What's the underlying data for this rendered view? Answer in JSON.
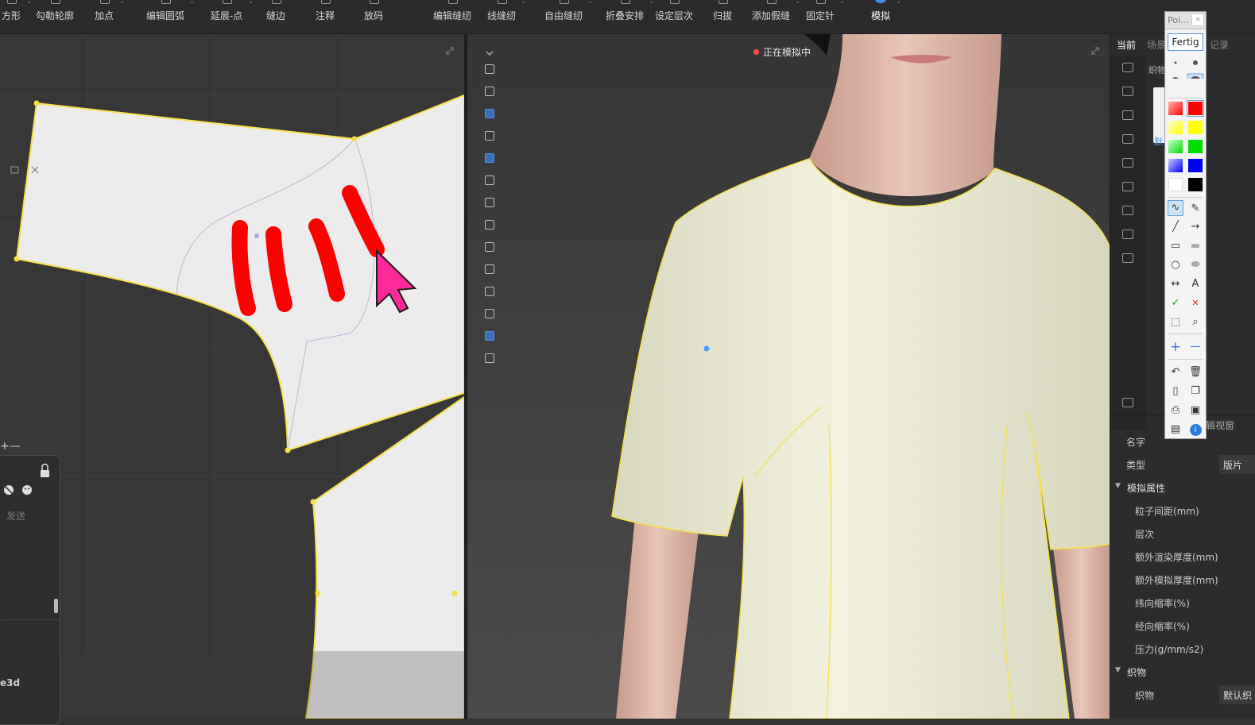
{
  "toolbar": {
    "items": [
      {
        "label": "方形"
      },
      {
        "label": "勾勒轮廓"
      },
      {
        "label": "加点"
      },
      {
        "label": "编辑圆弧"
      },
      {
        "label": "延展-点"
      },
      {
        "label": "缝边"
      },
      {
        "label": "注释"
      },
      {
        "label": "放码"
      },
      {
        "label": "编辑缝纫"
      },
      {
        "label": "线缝纫"
      },
      {
        "label": "自由缝纫"
      },
      {
        "label": "折叠安排"
      },
      {
        "label": "设定层次"
      },
      {
        "label": "归拔"
      },
      {
        "label": "添加假缝"
      },
      {
        "label": "固定针"
      },
      {
        "label": "模拟"
      }
    ],
    "caret": "⌄"
  },
  "view3d": {
    "status": "正在模拟中",
    "status_color": "#ff4d4d"
  },
  "left_panel": {
    "chat_send": "发送",
    "bottom_label": "e3d",
    "cross_mark": "+—"
  },
  "prop_panel": {
    "tabs": [
      "当前",
      "场景",
      "记录"
    ],
    "fabric_label": "织物",
    "default_link": "默",
    "edit_view_label": "辑视窗",
    "rows": [
      {
        "key": "名字",
        "value": "",
        "kind": "plain"
      },
      {
        "key": "类型",
        "value": "版片",
        "kind": "plain"
      },
      {
        "key": "模拟属性",
        "value": "",
        "kind": "group"
      },
      {
        "key": "粒子间距(mm)",
        "value": "",
        "kind": "sub"
      },
      {
        "key": "层次",
        "value": "",
        "kind": "sub"
      },
      {
        "key": "额外渲染厚度(mm)",
        "value": "",
        "kind": "sub"
      },
      {
        "key": "额外模拟厚度(mm)",
        "value": "",
        "kind": "sub"
      },
      {
        "key": "纬向缩率(%)",
        "value": "",
        "kind": "sub"
      },
      {
        "key": "经向缩率(%)",
        "value": "",
        "kind": "sub"
      },
      {
        "key": "压力(g/mm/s2)",
        "value": "",
        "kind": "sub"
      },
      {
        "key": "织物",
        "value": "",
        "kind": "group"
      },
      {
        "key": "织物",
        "value": "默认织",
        "kind": "sub"
      }
    ]
  },
  "palette": {
    "title": "Poi...",
    "close": "×",
    "done": "Fertig",
    "colors": [
      "#ff0000",
      "#ffff00",
      "#00dd00",
      "#0000ff",
      "#000000"
    ],
    "text_tool": "A",
    "check": "✓",
    "cross": "✕",
    "plus": "+",
    "minus": "—"
  },
  "colors": {
    "seam": "#f5e04a",
    "garment": "#f2f1de",
    "pattern_piece": "#ececec",
    "annotation": "#ff0000",
    "cursor": "#ff2a9a"
  }
}
